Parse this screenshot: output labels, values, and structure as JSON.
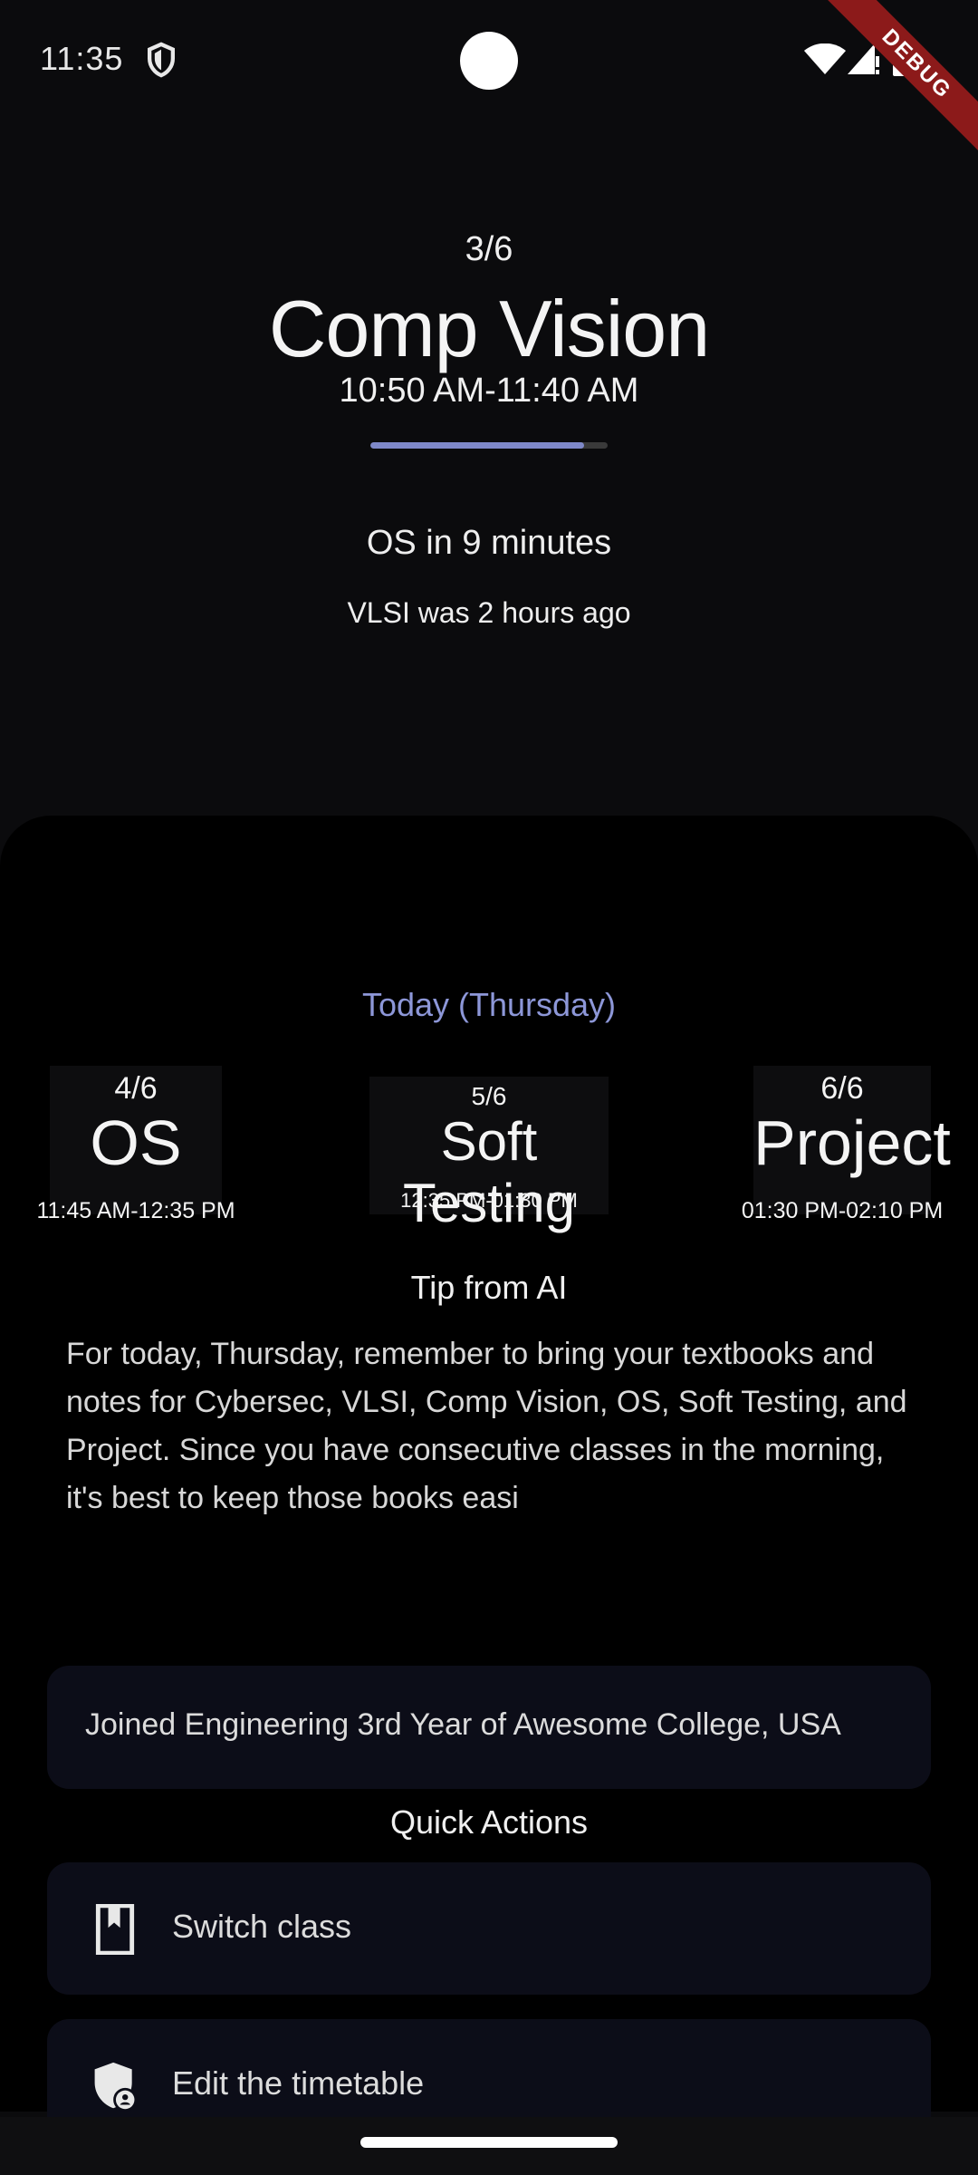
{
  "status_bar": {
    "time": "11:35",
    "debug_label": "DEBUG"
  },
  "current_class": {
    "index": "3/6",
    "name": "Comp Vision",
    "time": "10:50 AM-11:40 AM",
    "progress": 0.9
  },
  "next_class": "OS in 9 minutes",
  "previous_class": "VLSI was 2 hours ago",
  "today": {
    "label": "Today (Thursday)",
    "cards": [
      {
        "index": "4/6",
        "name": "OS",
        "time": "11:45 AM-12:35 PM"
      },
      {
        "index": "5/6",
        "name": "Soft Testing",
        "time": "12:35 PM-01:30 PM"
      },
      {
        "index": "6/6",
        "name": "Project",
        "time": "01:30 PM-02:10 PM"
      }
    ]
  },
  "tip": {
    "title": "Tip from AI",
    "body": "For today, Thursday, remember to bring your textbooks and notes for Cybersec, VLSI, Comp Vision, OS, Soft Testing, and Project. Since you have consecutive classes in the morning, it's best to keep those books easi"
  },
  "joined": "Joined Engineering 3rd Year of Awesome College, USA",
  "quick_actions": {
    "title": "Quick Actions",
    "items": [
      {
        "label": "Switch class",
        "icon": "book-icon"
      },
      {
        "label": "Edit the timetable",
        "icon": "admin-shield-icon"
      }
    ]
  },
  "colors": {
    "accent": "#8d97d8",
    "card": "#0c0d18",
    "progress": "#7e88c8"
  }
}
